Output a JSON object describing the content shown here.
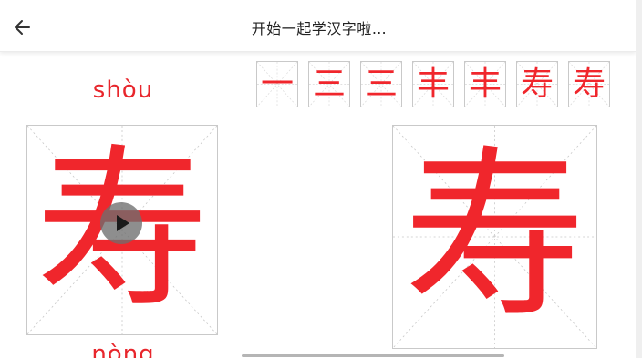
{
  "header": {
    "back_icon": "arrow-left-icon",
    "title": "开始一起学汉字啦…"
  },
  "lesson": {
    "pinyin": "shòu",
    "character": "寿",
    "next_pinyin_partial": "nòng"
  },
  "stroke_steps": [
    "一",
    "三",
    "三",
    "丰",
    "丰",
    "寿",
    "寿"
  ],
  "controls": {
    "play_icon": "play-icon"
  },
  "colors": {
    "accent": "#e8262c",
    "grid_line": "#c9c9c9"
  }
}
